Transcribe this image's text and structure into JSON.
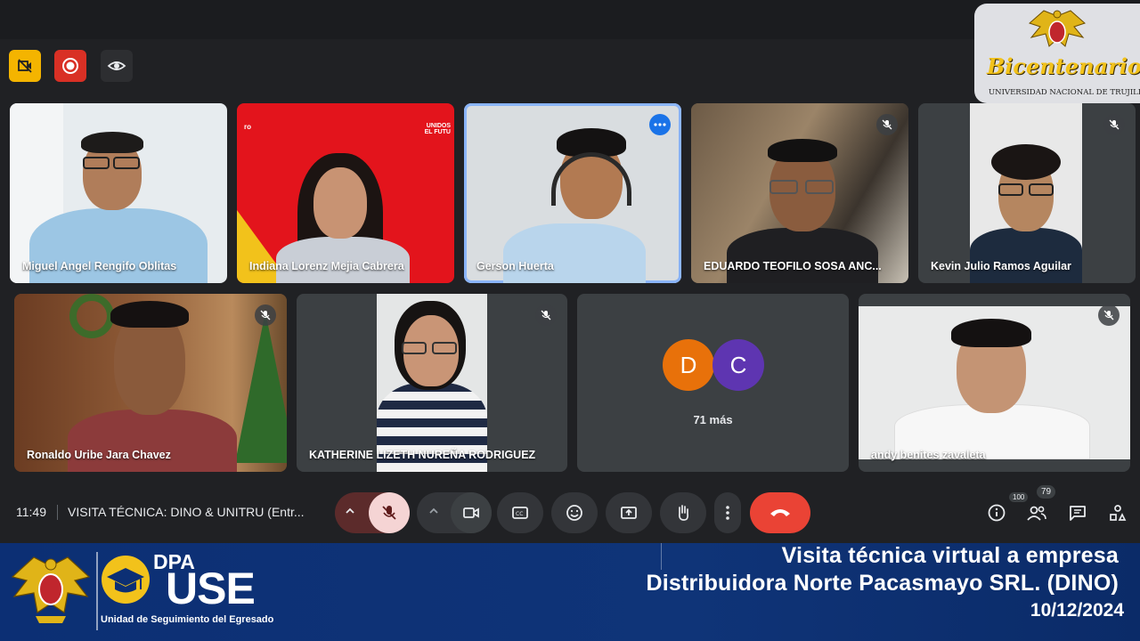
{
  "host_controls": [
    {
      "name": "host-video-off-icon",
      "color": "#f4b400"
    },
    {
      "name": "record-icon",
      "color": "#d93025"
    },
    {
      "name": "eye-icon",
      "color": "#3c4043"
    }
  ],
  "participants": [
    {
      "name": "Miguel Angel Rengifo Oblitas",
      "muted": false
    },
    {
      "name": "Indiana Lorenz Mejia Cabrera",
      "muted": false
    },
    {
      "name": "Gerson Huerta",
      "muted": false,
      "speaking": true
    },
    {
      "name": "EDUARDO TEOFILO SOSA ANC...",
      "muted": true
    },
    {
      "name": "Kevin Julio Ramos Aguilar",
      "muted": true
    },
    {
      "name": "Ronaldo Uribe Jara Chavez",
      "muted": true
    },
    {
      "name": "KATHERINE LIZETH NUREÑA RODRIGUEZ",
      "muted": true
    },
    {
      "name": "andy benites zavaleta",
      "muted": true
    }
  ],
  "others_tile": {
    "avatars": [
      {
        "letter": "D",
        "color": "#e8710a"
      },
      {
        "letter": "C",
        "color": "#5e35b1"
      }
    ],
    "more_label": "71 más"
  },
  "bg_texts": {
    "red_tile_brand_left": "ro",
    "red_tile_brand_right": "UNIDOS\nEL FUTU"
  },
  "control_bar": {
    "time": "11:49",
    "meeting_title": "VISITA TÉCNICA: DINO & UNITRU (Entr...",
    "buttons": [
      "chevron-up-icon",
      "mic-off-icon",
      "chevron-up-icon",
      "camera-icon",
      "captions-icon",
      "emoji-icon",
      "present-icon",
      "raise-hand-icon",
      "more-vert-icon",
      "end-call-icon"
    ],
    "right_icons": [
      "info-icon",
      "people-icon",
      "chat-icon",
      "activities-icon"
    ],
    "people_count": "79",
    "people_cap": "100"
  },
  "banner": {
    "dpa_label": "DPA",
    "use_label": "USE",
    "use_subtitle": "Unidad de Seguimiento del Egresado",
    "title_line1": "Visita técnica virtual a empresa",
    "title_line2": "Distribuidora Norte Pacasmayo SRL. (DINO)",
    "date": "10/12/2024"
  },
  "bicentenario": {
    "word": "Bicentenario",
    "subtitle": "UNIVERSIDAD NACIONAL DE TRUJILLO"
  },
  "colors": {
    "meet_bg": "#202124",
    "accent_blue": "#8ab4f8",
    "end_call_red": "#ea4335",
    "banner_blue": "#0c2f74",
    "gold": "#f2c21b"
  }
}
